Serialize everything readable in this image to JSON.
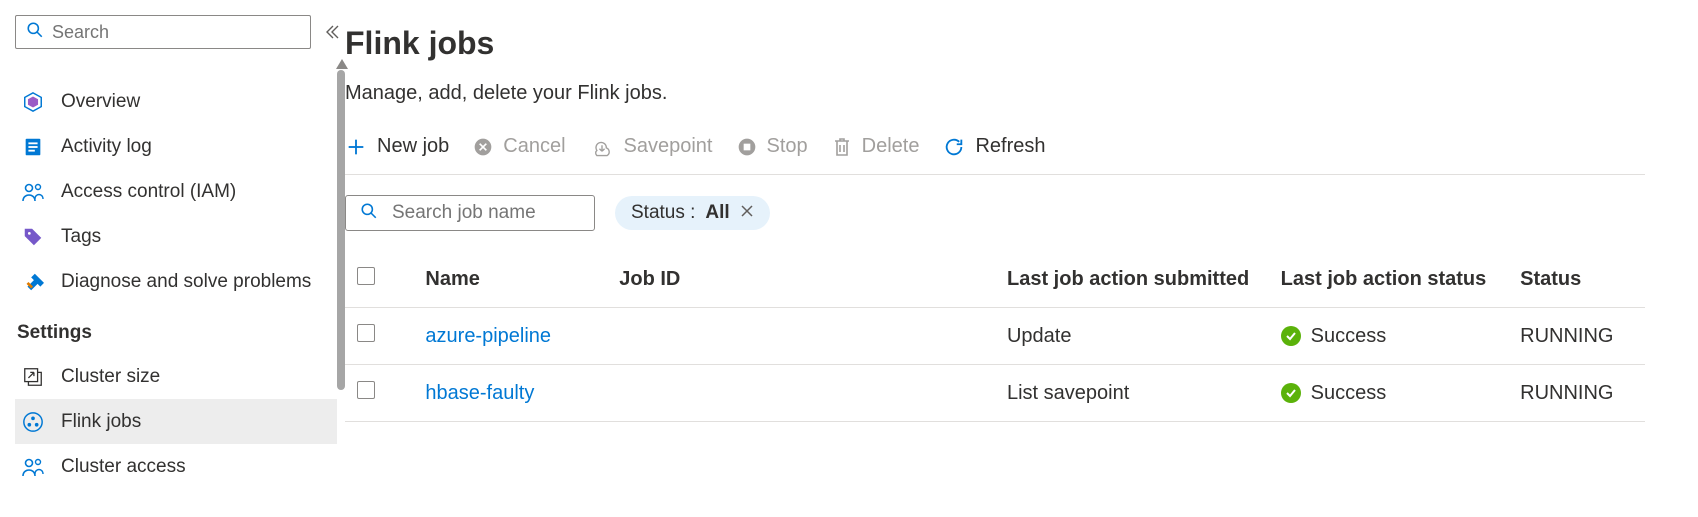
{
  "sidebar": {
    "search_placeholder": "Search",
    "items": [
      {
        "id": "overview",
        "label": "Overview"
      },
      {
        "id": "activity-log",
        "label": "Activity log"
      },
      {
        "id": "access-control",
        "label": "Access control (IAM)"
      },
      {
        "id": "tags",
        "label": "Tags"
      },
      {
        "id": "diagnose",
        "label": "Diagnose and solve problems"
      }
    ],
    "section_label": "Settings",
    "settings_items": [
      {
        "id": "cluster-size",
        "label": "Cluster size"
      },
      {
        "id": "flink-jobs",
        "label": "Flink jobs",
        "selected": true
      },
      {
        "id": "cluster-access",
        "label": "Cluster access"
      }
    ]
  },
  "main": {
    "title": "Flink jobs",
    "subtitle": "Manage, add, delete your Flink jobs.",
    "toolbar": {
      "new_job": "New job",
      "cancel": "Cancel",
      "savepoint": "Savepoint",
      "stop": "Stop",
      "delete": "Delete",
      "refresh": "Refresh"
    },
    "job_search_placeholder": "Search job name",
    "filter_pill": {
      "prefix": "Status : ",
      "value": "All"
    },
    "columns": {
      "name": "Name",
      "job_id": "Job ID",
      "last_action_submitted": "Last job action submitted",
      "last_action_status": "Last job action status",
      "status": "Status"
    },
    "rows": [
      {
        "name": "azure-pipeline",
        "job_id": "",
        "last_action_submitted": "Update",
        "last_action_status": "Success",
        "status": "RUNNING"
      },
      {
        "name": "hbase-faulty",
        "job_id": "",
        "last_action_submitted": "List savepoint",
        "last_action_status": "Success",
        "status": "RUNNING"
      }
    ]
  }
}
